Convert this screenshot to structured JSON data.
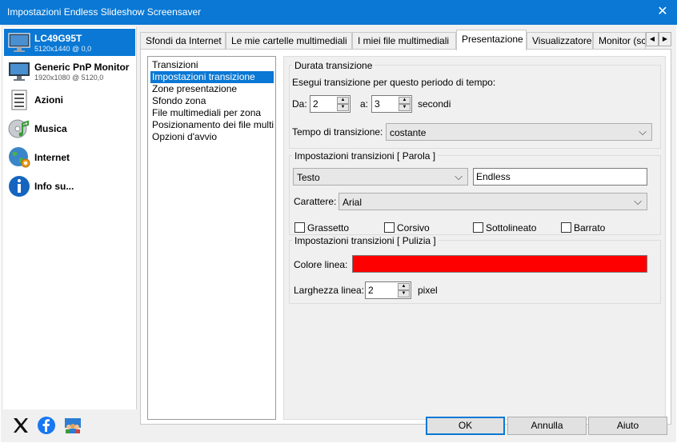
{
  "window": {
    "title": "Impostazioni Endless Slideshow Screensaver",
    "close_glyph": "✕"
  },
  "sidebar": {
    "items": [
      {
        "name": "LC49G95T",
        "sub": "5120x1440 @ 0,0",
        "icon": "monitor-icon"
      },
      {
        "name": "Generic PnP Monitor",
        "sub": "1920x1080 @ 5120,0",
        "icon": "monitor-icon"
      },
      {
        "name": "Azioni",
        "icon": "actions-icon"
      },
      {
        "name": "Musica",
        "icon": "music-icon"
      },
      {
        "name": "Internet",
        "icon": "globe-icon"
      },
      {
        "name": "Info su...",
        "icon": "info-icon"
      }
    ]
  },
  "tabs": [
    "Sfondi da Internet",
    "Le mie cartelle multimediali",
    "I miei file multimediali",
    "Presentazione",
    "Visualizzatore",
    "Monitor (sc"
  ],
  "tab_scroll": {
    "left": "◀",
    "right": "▶"
  },
  "tree": [
    "Transizioni",
    "Impostazioni transizione",
    "Zone presentazione",
    "Sfondo zona",
    "File multimediali per zona",
    "Posizionamento dei file multi",
    "Opzioni d'avvio"
  ],
  "duration": {
    "group": "Durata transizione",
    "instruction": "Esegui transizione per questo periodo di tempo:",
    "from_label": "Da:",
    "from_value": "2",
    "to_label": "a:",
    "to_value": "3",
    "unit": "secondi",
    "time_label": "Tempo di transizione:",
    "time_value": "costante"
  },
  "word": {
    "group": "Impostazioni transizioni [ Parola ]",
    "type_value": "Testo",
    "text_value": "Endless",
    "font_label": "Carattere:",
    "font_value": "Arial",
    "checks": [
      "Grassetto",
      "Corsivo",
      "Sottolineato",
      "Barrato"
    ]
  },
  "clean": {
    "group": "Impostazioni transizioni [ Pulizia ]",
    "color_label": "Colore linea:",
    "color": "#ff0000",
    "width_label": "Larghezza linea:",
    "width_value": "2",
    "width_unit": "pixel"
  },
  "buttons": {
    "ok": "OK",
    "cancel": "Annulla",
    "help": "Aiuto"
  },
  "social": [
    "x-icon",
    "facebook-icon",
    "community-icon"
  ],
  "glyphs": {
    "up": "▲",
    "down": "▼",
    "chevron": "⌵"
  },
  "colors": {
    "accent": "#0a78d4",
    "titlebar": "#0a78d4"
  }
}
